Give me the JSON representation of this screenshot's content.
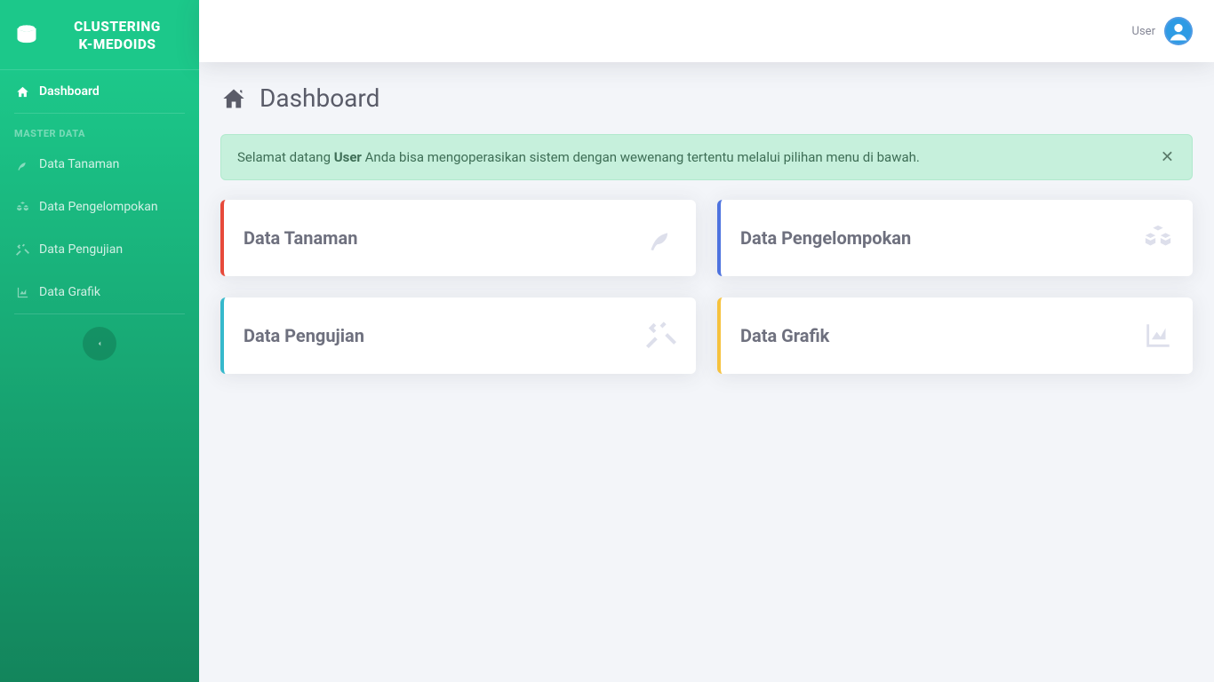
{
  "brand": {
    "line1": "CLUSTERING",
    "line2": "K-MEDOIDS"
  },
  "sidebar": {
    "dashboard_label": "Dashboard",
    "section_heading": "MASTER DATA",
    "items": [
      {
        "label": "Data Tanaman"
      },
      {
        "label": "Data Pengelompokan"
      },
      {
        "label": "Data Pengujian"
      },
      {
        "label": "Data Grafik"
      }
    ]
  },
  "topbar": {
    "user_label": "User"
  },
  "page": {
    "title": "Dashboard"
  },
  "alert": {
    "prefix": "Selamat datang ",
    "bold": "User",
    "suffix": " Anda bisa mengoperasikan sistem dengan wewenang tertentu melalui pilihan menu di bawah."
  },
  "cards": [
    {
      "title": "Data Tanaman",
      "accent": "red",
      "icon": "leaf-icon"
    },
    {
      "title": "Data Pengelompokan",
      "accent": "blue",
      "icon": "cubes-icon"
    },
    {
      "title": "Data Pengujian",
      "accent": "cyan",
      "icon": "tools-icon"
    },
    {
      "title": "Data Grafik",
      "accent": "yellow",
      "icon": "chart-area-icon"
    }
  ],
  "colors": {
    "red": "#e74a3b",
    "blue": "#4e73df",
    "cyan": "#36b9cc",
    "yellow": "#f6c23e",
    "sidebar_gradient_top": "#1cc88a",
    "sidebar_gradient_bottom": "#13855c"
  }
}
